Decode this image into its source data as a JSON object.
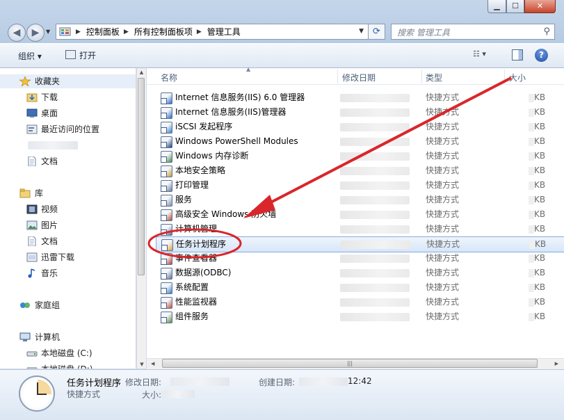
{
  "window": {
    "buttons": {
      "minimize": "▁",
      "maximize": "☐",
      "close": "✕"
    }
  },
  "navigation": {
    "back": "◀",
    "forward": "▶",
    "address_crumbs": [
      "控制面板",
      "所有控制面板项",
      "管理工具"
    ],
    "search_placeholder": "搜索 管理工具"
  },
  "toolbar": {
    "organize_label": "组织 ▾",
    "open_label": "打开",
    "views_label": "☷ ▾",
    "help_label": "?"
  },
  "sidebar": {
    "favorites": {
      "label": "收藏夹",
      "items": [
        "下载",
        "桌面",
        "最近访问的位置",
        "",
        "文档"
      ]
    },
    "library": {
      "label": "库",
      "items": [
        "视频",
        "图片",
        "文档",
        "迅雷下载",
        "音乐"
      ]
    },
    "homegroup": "家庭组",
    "computer": {
      "label": "计算机",
      "items": [
        "本地磁盘 (C:)",
        "本地磁盘 (D:)"
      ]
    }
  },
  "file_list": {
    "columns": {
      "name": "名称",
      "modified": "修改日期",
      "type": "类型",
      "size": "大小"
    },
    "rows": [
      {
        "name": "Internet 信息服务(IIS) 6.0 管理器",
        "type": "快捷方式",
        "size": "KB"
      },
      {
        "name": "Internet 信息服务(IIS)管理器",
        "type": "快捷方式",
        "size": "KB"
      },
      {
        "name": "iSCSI 发起程序",
        "type": "快捷方式",
        "size": "KB"
      },
      {
        "name": "Windows PowerShell Modules",
        "type": "快捷方式",
        "size": "KB"
      },
      {
        "name": "Windows 内存诊断",
        "type": "快捷方式",
        "size": "KB"
      },
      {
        "name": "本地安全策略",
        "type": "快捷方式",
        "size": "KB"
      },
      {
        "name": "打印管理",
        "type": "快捷方式",
        "size": "KB"
      },
      {
        "name": "服务",
        "type": "快捷方式",
        "size": "KB"
      },
      {
        "name": "高级安全 Windows 防火墙",
        "type": "快捷方式",
        "size": "KB"
      },
      {
        "name": "计算机管理",
        "type": "快捷方式",
        "size": "KB"
      },
      {
        "name": "任务计划程序",
        "type": "快捷方式",
        "size": "KB",
        "selected": true
      },
      {
        "name": "事件查看器",
        "type": "快捷方式",
        "size": "KB"
      },
      {
        "name": "数据源(ODBC)",
        "type": "快捷方式",
        "size": "KB"
      },
      {
        "name": "系统配置",
        "type": "快捷方式",
        "size": "KB"
      },
      {
        "name": "性能监视器",
        "type": "快捷方式",
        "size": "KB"
      },
      {
        "name": "组件服务",
        "type": "快捷方式",
        "size": "KB"
      }
    ]
  },
  "details": {
    "name": "任务计划程序",
    "kind": "快捷方式",
    "modified_label": "修改日期:",
    "created_label": "创建日期:",
    "size_label": "大小:",
    "created_tail": "12:42"
  },
  "annotation": {
    "color": "#d9262b"
  }
}
